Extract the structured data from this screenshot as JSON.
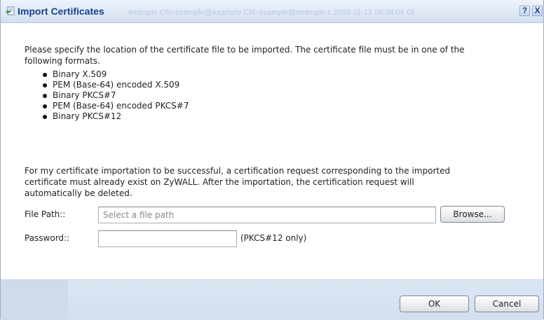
{
  "dialog": {
    "title": "Import Certificates",
    "title_background_text": "example     CN=example@example   CN=example@example.c 2009-11-13 05:38:05 Ol",
    "help_label": "?",
    "close_label": "X"
  },
  "content": {
    "intro": "Please specify the location of the certificate file to be imported. The certificate file must be in one of the following formats.",
    "formats": [
      "Binary X.509",
      "PEM (Base-64) encoded X.509",
      "Binary PKCS#7",
      "PEM (Base-64) encoded PKCS#7",
      "Binary PKCS#12"
    ],
    "note": "For my certificate importation to be successful, a certification request corresponding to the imported certificate must already exist on ZyWALL. After the importation, the certification request will automatically be deleted."
  },
  "form": {
    "file_path_label": "File Path::",
    "file_path_placeholder": "Select a file path",
    "file_path_value": "",
    "browse_label": "Browse...",
    "password_label": "Password::",
    "password_value": "",
    "password_hint": "(PKCS#12 only)"
  },
  "footer": {
    "ok_label": "OK",
    "cancel_label": "Cancel"
  },
  "colors": {
    "title_text": "#15428b",
    "footer_bg": "#d4deee"
  },
  "icons": {
    "title": "import-certificate-icon",
    "help": "help-icon",
    "close": "close-icon"
  }
}
